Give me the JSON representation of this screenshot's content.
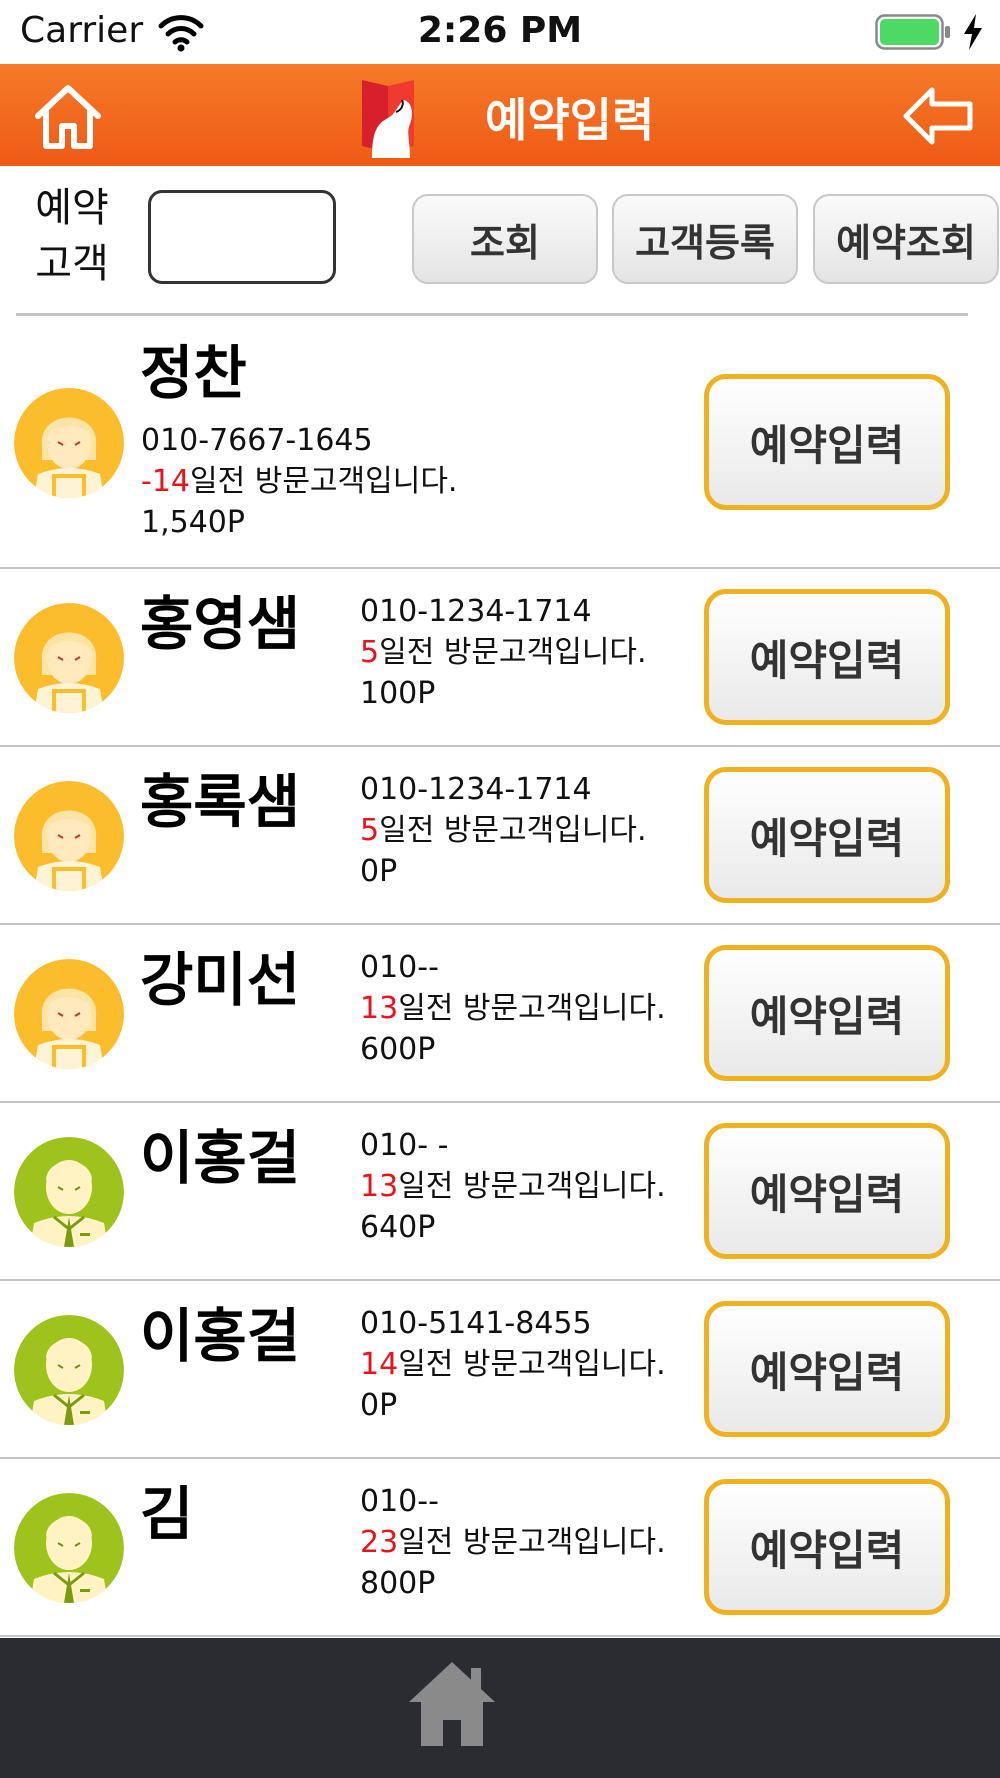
{
  "status_bar": {
    "carrier": "Carrier",
    "time": "2:26 PM"
  },
  "header": {
    "title": "예약입력"
  },
  "search": {
    "label_line1": "예약",
    "label_line2": "고객",
    "input_value": "",
    "search_btn": "조회",
    "register_btn": "고객등록",
    "lookup_btn": "예약조회"
  },
  "customers": [
    {
      "name": "정찬",
      "phone": "010-7667-1645",
      "days": "-14",
      "visit_suffix": "일전 방문고객입니다.",
      "points": "1,540P",
      "avatar": "female",
      "action": "예약입력"
    },
    {
      "name": "홍영샘",
      "phone": "010-1234-1714",
      "days": "5",
      "visit_suffix": "일전 방문고객입니다.",
      "points": "100P",
      "avatar": "female",
      "action": "예약입력"
    },
    {
      "name": "홍록샘",
      "phone": "010-1234-1714",
      "days": "5",
      "visit_suffix": "일전 방문고객입니다.",
      "points": "0P",
      "avatar": "female",
      "action": "예약입력"
    },
    {
      "name": "강미선",
      "phone": "010--",
      "days": "13",
      "visit_suffix": "일전 방문고객입니다.",
      "points": "600P",
      "avatar": "female",
      "action": "예약입력"
    },
    {
      "name": "이홍걸",
      "phone": "010- -",
      "days": "13",
      "visit_suffix": "일전 방문고객입니다.",
      "points": "640P",
      "avatar": "male",
      "action": "예약입력"
    },
    {
      "name": "이홍걸",
      "phone": "010-5141-8455",
      "days": "14",
      "visit_suffix": "일전 방문고객입니다.",
      "points": "0P",
      "avatar": "male",
      "action": "예약입력"
    },
    {
      "name": "김",
      "phone": "010--",
      "days": "23",
      "visit_suffix": "일전 방문고객입니다.",
      "points": "800P",
      "avatar": "male",
      "action": "예약입력"
    }
  ],
  "colors": {
    "header": "#f16a1f",
    "accent_border": "#eeb11f",
    "days_red": "#e8141c",
    "footer": "#2b2c30",
    "female_avatar": "#fbbd2c",
    "male_avatar": "#9ec31c"
  }
}
